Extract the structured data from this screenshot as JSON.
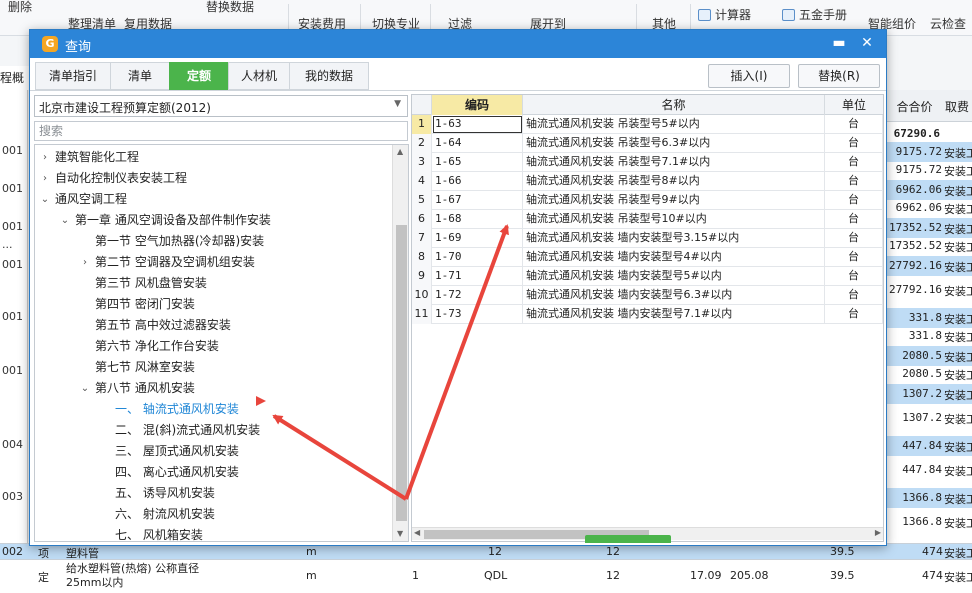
{
  "app": {
    "toolbar": [
      {
        "label": "删除"
      },
      {
        "label": "整理清单"
      },
      {
        "label": "复用数据"
      },
      {
        "label": "替换数据"
      },
      {
        "label": "安装费用"
      },
      {
        "label": "切换专业"
      },
      {
        "label": "过滤"
      },
      {
        "label": "展开到"
      },
      {
        "label": "其他"
      },
      {
        "label": "计算器"
      },
      {
        "label": "五金手册"
      },
      {
        "label": "智能组价"
      },
      {
        "label": "云检查"
      }
    ],
    "left_tab": "程概况",
    "left_codes": [
      "001",
      "001",
      "001",
      "...",
      "001",
      "001",
      "001",
      "004",
      "003",
      "002"
    ],
    "right_header": {
      "col1": "合合价",
      "col2": "取费"
    },
    "right_total": "67290.6",
    "right_rows": [
      {
        "value": "9175.72",
        "fee": "安装工"
      },
      {
        "value": "9175.72",
        "fee": "安装工"
      },
      {
        "value": "6962.06",
        "fee": "安装工"
      },
      {
        "value": "6962.06",
        "fee": "安装工"
      },
      {
        "value": "17352.52",
        "fee": "安装工"
      },
      {
        "value": "17352.52",
        "fee": "安装工"
      },
      {
        "value": "27792.16",
        "fee": "安装工"
      },
      {
        "value": "27792.16",
        "fee": "安装工"
      },
      {
        "value": "331.8",
        "fee": "安装工"
      },
      {
        "value": "331.8",
        "fee": "安装工"
      },
      {
        "value": "2080.5",
        "fee": "安装工"
      },
      {
        "value": "2080.5",
        "fee": "安装工"
      },
      {
        "value": "1307.2",
        "fee": "安装工"
      },
      {
        "value": "1307.2",
        "fee": "安装工"
      },
      {
        "value": "447.84",
        "fee": "安装工"
      },
      {
        "value": "447.84",
        "fee": "安装工"
      },
      {
        "value": "1366.8",
        "fee": "安装工"
      },
      {
        "value": "1366.8",
        "fee": "安装工"
      }
    ],
    "bottom_row1": {
      "code": "002",
      "type": "项",
      "name": "塑料管",
      "unit": "m",
      "qty": "12",
      "qty2": "12",
      "price": "39.5",
      "total": "474",
      "fee": "安装工"
    },
    "bottom_row2": {
      "type": "定",
      "name": "给水塑料管(热熔) 公称直径25mm以内",
      "unit": "m",
      "qty": "1",
      "qdl": "QDL",
      "qty2": "12",
      "p1": "17.09",
      "p2": "205.08",
      "price": "39.5",
      "total": "474",
      "fee": "安装工"
    }
  },
  "dialog": {
    "title": "查询",
    "tabs": [
      "清单指引",
      "清单",
      "定额",
      "人材机",
      "我的数据"
    ],
    "active_tab": 2,
    "insert_button": "插入(I)",
    "replace_button": "替换(R)",
    "library": "北京市建设工程预算定额(2012)",
    "search_placeholder": "搜索",
    "tree": [
      {
        "label": "建筑智能化工程",
        "level": 0,
        "caret": "›"
      },
      {
        "label": "自动化控制仪表安装工程",
        "level": 0,
        "caret": "›"
      },
      {
        "label": "通风空调工程",
        "level": 0,
        "caret": "⌄"
      },
      {
        "label": "第一章 通风空调设备及部件制作安装",
        "level": 1,
        "caret": "⌄"
      },
      {
        "label": "第一节 空气加热器(冷却器)安装",
        "level": 2,
        "caret": ""
      },
      {
        "label": "第二节 空调器及空调机组安装",
        "level": 2,
        "caret": "›"
      },
      {
        "label": "第三节 风机盘管安装",
        "level": 2,
        "caret": ""
      },
      {
        "label": "第四节 密闭门安装",
        "level": 2,
        "caret": ""
      },
      {
        "label": "第五节 高中效过滤器安装",
        "level": 2,
        "caret": ""
      },
      {
        "label": "第六节 净化工作台安装",
        "level": 2,
        "caret": ""
      },
      {
        "label": "第七节 风淋室安装",
        "level": 2,
        "caret": ""
      },
      {
        "label": "第八节 通风机安装",
        "level": 2,
        "caret": "⌄"
      },
      {
        "label": "一、 轴流式通风机安装",
        "level": 3,
        "caret": "",
        "selected": true
      },
      {
        "label": "二、 混(斜)流式通风机安装",
        "level": 3,
        "caret": ""
      },
      {
        "label": "三、 屋顶式通风机安装",
        "level": 3,
        "caret": ""
      },
      {
        "label": "四、 离心式通风机安装",
        "level": 3,
        "caret": ""
      },
      {
        "label": "五、 诱导风机安装",
        "level": 3,
        "caret": ""
      },
      {
        "label": "六、 射流风机安装",
        "level": 3,
        "caret": ""
      },
      {
        "label": "七、 风机箱安装",
        "level": 3,
        "caret": ""
      }
    ],
    "grid": {
      "headers": {
        "code": "编码",
        "name": "名称",
        "unit": "单位"
      },
      "rows": [
        {
          "n": "1",
          "code": "1-63",
          "name": "轴流式通风机安装 吊装型号5#以内",
          "unit": "台"
        },
        {
          "n": "2",
          "code": "1-64",
          "name": "轴流式通风机安装 吊装型号6.3#以内",
          "unit": "台"
        },
        {
          "n": "3",
          "code": "1-65",
          "name": "轴流式通风机安装 吊装型号7.1#以内",
          "unit": "台"
        },
        {
          "n": "4",
          "code": "1-66",
          "name": "轴流式通风机安装 吊装型号8#以内",
          "unit": "台"
        },
        {
          "n": "5",
          "code": "1-67",
          "name": "轴流式通风机安装 吊装型号9#以内",
          "unit": "台"
        },
        {
          "n": "6",
          "code": "1-68",
          "name": "轴流式通风机安装 吊装型号10#以内",
          "unit": "台"
        },
        {
          "n": "7",
          "code": "1-69",
          "name": "轴流式通风机安装 墙内安装型号3.15#以内",
          "unit": "台"
        },
        {
          "n": "8",
          "code": "1-70",
          "name": "轴流式通风机安装 墙内安装型号4#以内",
          "unit": "台"
        },
        {
          "n": "9",
          "code": "1-71",
          "name": "轴流式通风机安装 墙内安装型号5#以内",
          "unit": "台"
        },
        {
          "n": "10",
          "code": "1-72",
          "name": "轴流式通风机安装 墙内安装型号6.3#以内",
          "unit": "台"
        },
        {
          "n": "11",
          "code": "1-73",
          "name": "轴流式通风机安装 墙内安装型号7.1#以内",
          "unit": "台"
        }
      ]
    }
  },
  "colors": {
    "title_bar": "#2c85d8",
    "active_tab": "#4bb44b",
    "highlight_row": "#bfdcf5",
    "arrow": "#e8453c",
    "code_header": "#f7eaa5",
    "selected_tree": "#1f86d6"
  }
}
